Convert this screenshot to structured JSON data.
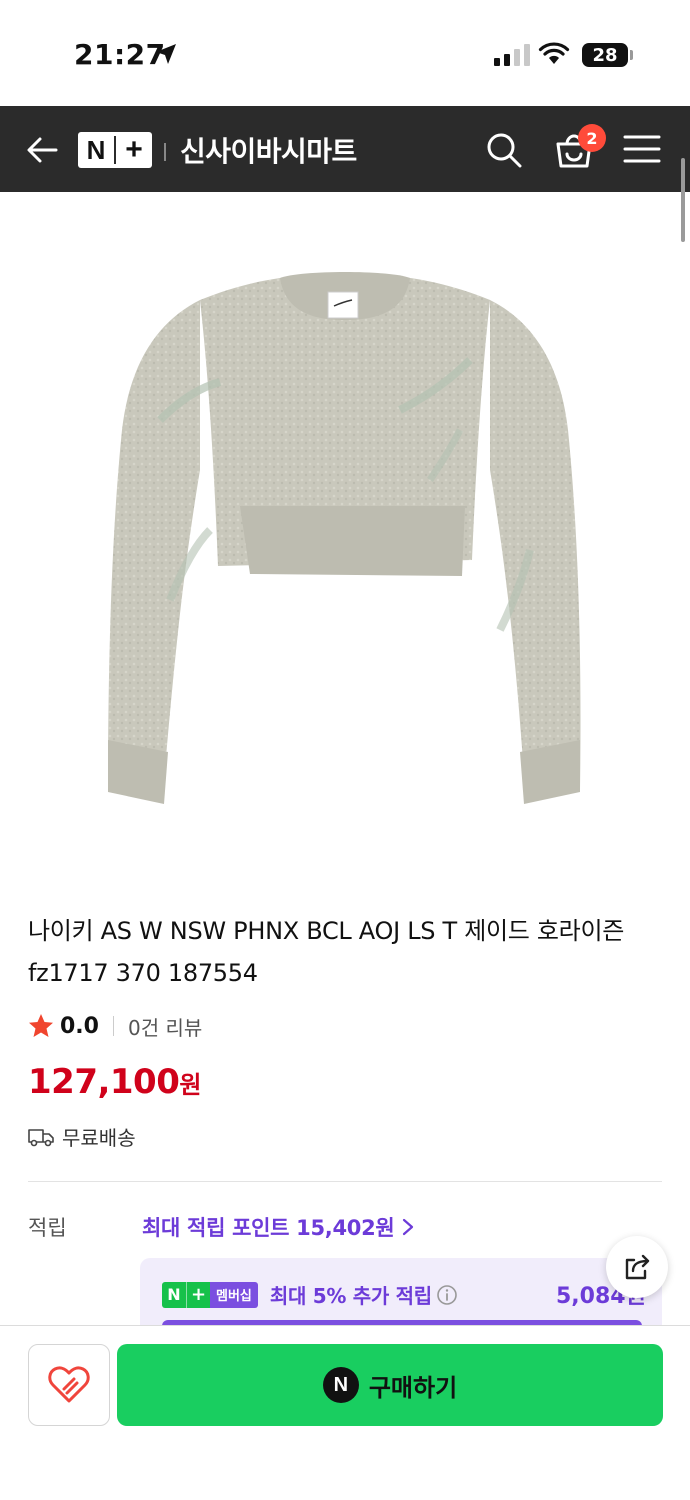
{
  "status_bar": {
    "time": "21:27",
    "battery": "28",
    "icons": [
      "location-arrow-icon",
      "signal-icon",
      "wifi-icon",
      "battery-icon"
    ]
  },
  "header": {
    "logo_n": "N",
    "logo_plus": "+",
    "store_name": "신사이바시마트",
    "cart_count": "2",
    "icons": [
      "back-arrow-icon",
      "search-icon",
      "cart-icon",
      "menu-icon"
    ],
    "background_color": "#2b2b2b"
  },
  "product": {
    "image_icon": "sweater-image",
    "title": "나이키 AS W NSW PHNX BCL AOJ LS T 제이드 호라이즌 fz1717 370 187554",
    "rating": "0.0",
    "review_count": "0건 리뷰",
    "price": "127,100",
    "price_unit": "원",
    "shipping": "무료배송",
    "price_color": "#d0021b"
  },
  "points": {
    "label": "적립",
    "max_points": "최대 적립 포인트 15,402원",
    "accent_color": "#6c3bd8"
  },
  "membership": {
    "badge_n": "N",
    "badge_plus": "+",
    "badge_label": "멤버십",
    "text": "최대 5% 추가 적립",
    "amount": "5,084원"
  },
  "bottom_bar": {
    "buy_icon": "N",
    "buy_label": "구매하기",
    "buy_color": "#19ce60"
  }
}
